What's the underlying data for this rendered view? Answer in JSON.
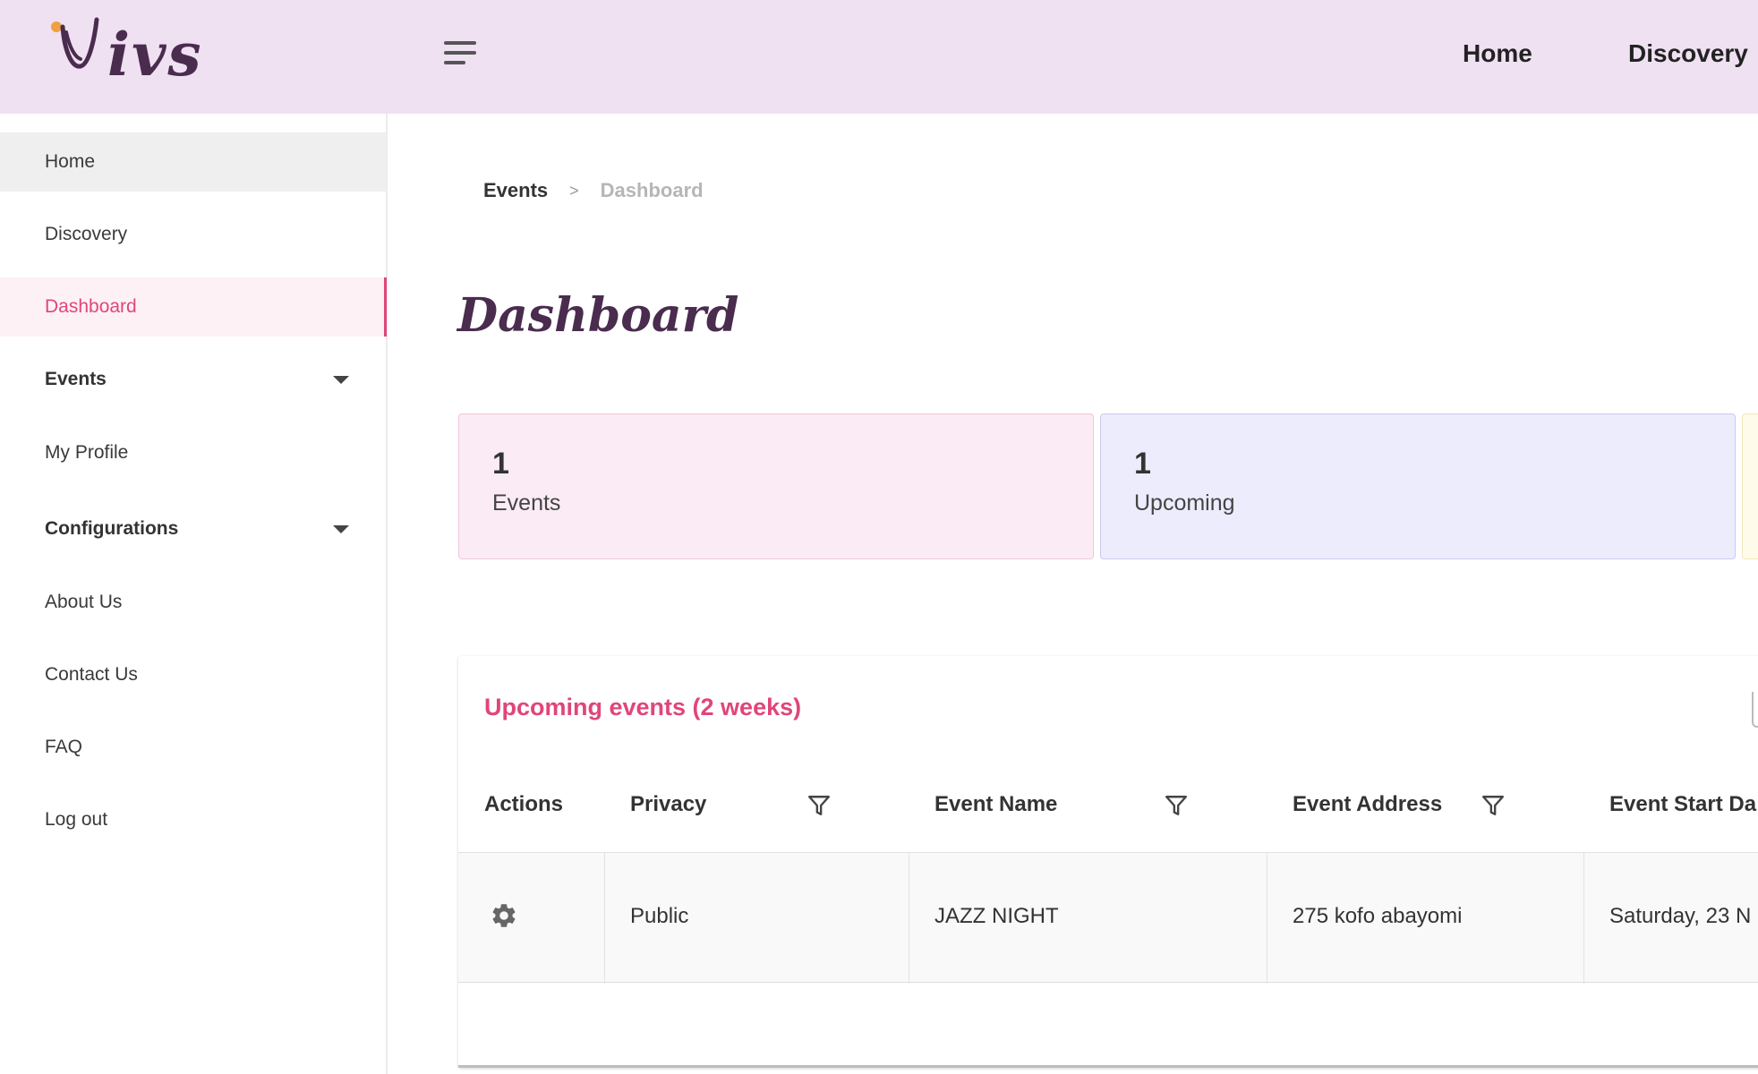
{
  "app": {
    "logo_text": "ivs"
  },
  "topnav": {
    "home": "Home",
    "discovery": "Discovery"
  },
  "sidebar": {
    "items": [
      {
        "label": "Home"
      },
      {
        "label": "Discovery"
      },
      {
        "label": "Dashboard"
      },
      {
        "label": "Events"
      },
      {
        "label": "My Profile"
      },
      {
        "label": "Configurations"
      },
      {
        "label": "About Us"
      },
      {
        "label": "Contact Us"
      },
      {
        "label": "FAQ"
      },
      {
        "label": "Log out"
      }
    ]
  },
  "breadcrumb": {
    "parent": "Events",
    "separator": ">",
    "current": "Dashboard"
  },
  "page": {
    "title": "Dashboard"
  },
  "stats": [
    {
      "value": "1",
      "label": "Events"
    },
    {
      "value": "1",
      "label": "Upcoming"
    }
  ],
  "upcoming": {
    "title": "Upcoming events (2 weeks)",
    "columns": [
      "Actions",
      "Privacy",
      "Event Name",
      "Event Address",
      "Event Start Da"
    ],
    "rows": [
      {
        "privacy": "Public",
        "event_name": "JAZZ NIGHT",
        "event_address": "275 kofo abayomi",
        "event_start": "Saturday, 23 N"
      }
    ]
  },
  "icons": {
    "menu": "hamburger-menu-icon",
    "caret": "caret-down-icon",
    "filter": "filter-icon",
    "settings": "gear-icon"
  },
  "colors": {
    "topbar": "#efe0f2",
    "accent": "#e0457b",
    "brand_dark": "#4a2c4e",
    "card_pink": "#fbebf4",
    "card_lavender": "#ececfd",
    "card_yellow": "#fffbea"
  }
}
